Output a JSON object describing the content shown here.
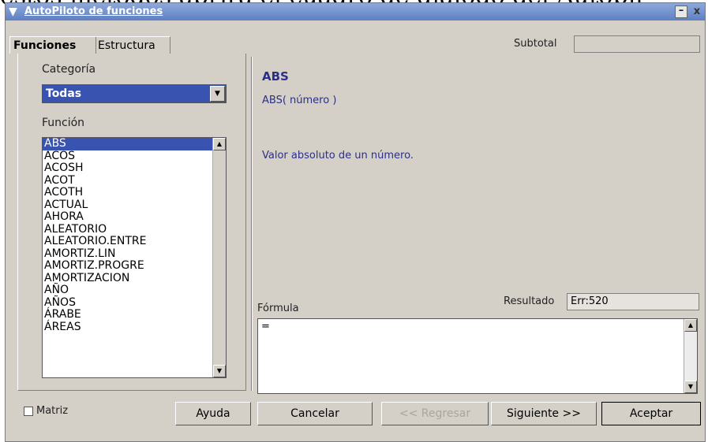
{
  "background_text": "estos métodos abrirá el cuadro de diálogo del Autopil",
  "window": {
    "title": "AutoPiloto de funciones",
    "menu_icon": "▼",
    "minimize": "–",
    "close": "x"
  },
  "tabs": [
    {
      "label": "Funciones",
      "active": true
    },
    {
      "label": "Estructura",
      "active": false
    }
  ],
  "categoria": {
    "label": "Categoría",
    "selected": "Todas"
  },
  "funcion": {
    "label": "Función",
    "items": [
      "ABS",
      "ACOS",
      "ACOSH",
      "ACOT",
      "ACOTH",
      "ACTUAL",
      "AHORA",
      "ALEATORIO",
      "ALEATORIO.ENTRE",
      "AMORTIZ.LIN",
      "AMORTIZ.PROGRE",
      "AMORTIZACION",
      "AÑO",
      "AÑOS",
      "ÁRABE",
      "ÁREAS"
    ],
    "selected_index": 0
  },
  "subtotal": {
    "label": "Subtotal",
    "value": ""
  },
  "details": {
    "name": "ABS",
    "syntax": "ABS( número )",
    "description": "Valor absoluto de un número."
  },
  "formula": {
    "label": "Fórmula",
    "value": "="
  },
  "resultado": {
    "label": "Resultado",
    "value": "Err:520"
  },
  "matriz": {
    "label": "Matriz",
    "checked": false
  },
  "buttons": {
    "ayuda": "Ayuda",
    "cancelar": "Cancelar",
    "regresar": "<< Regresar",
    "siguiente": "Siguiente >>",
    "aceptar": "Aceptar"
  },
  "icons": {
    "dropdown": "▼",
    "scroll_up": "▲",
    "scroll_down": "▼"
  },
  "colors": {
    "selection": "#3953b0",
    "title_bar": "#5d7fc4",
    "detail_text": "#2a2f8a"
  }
}
